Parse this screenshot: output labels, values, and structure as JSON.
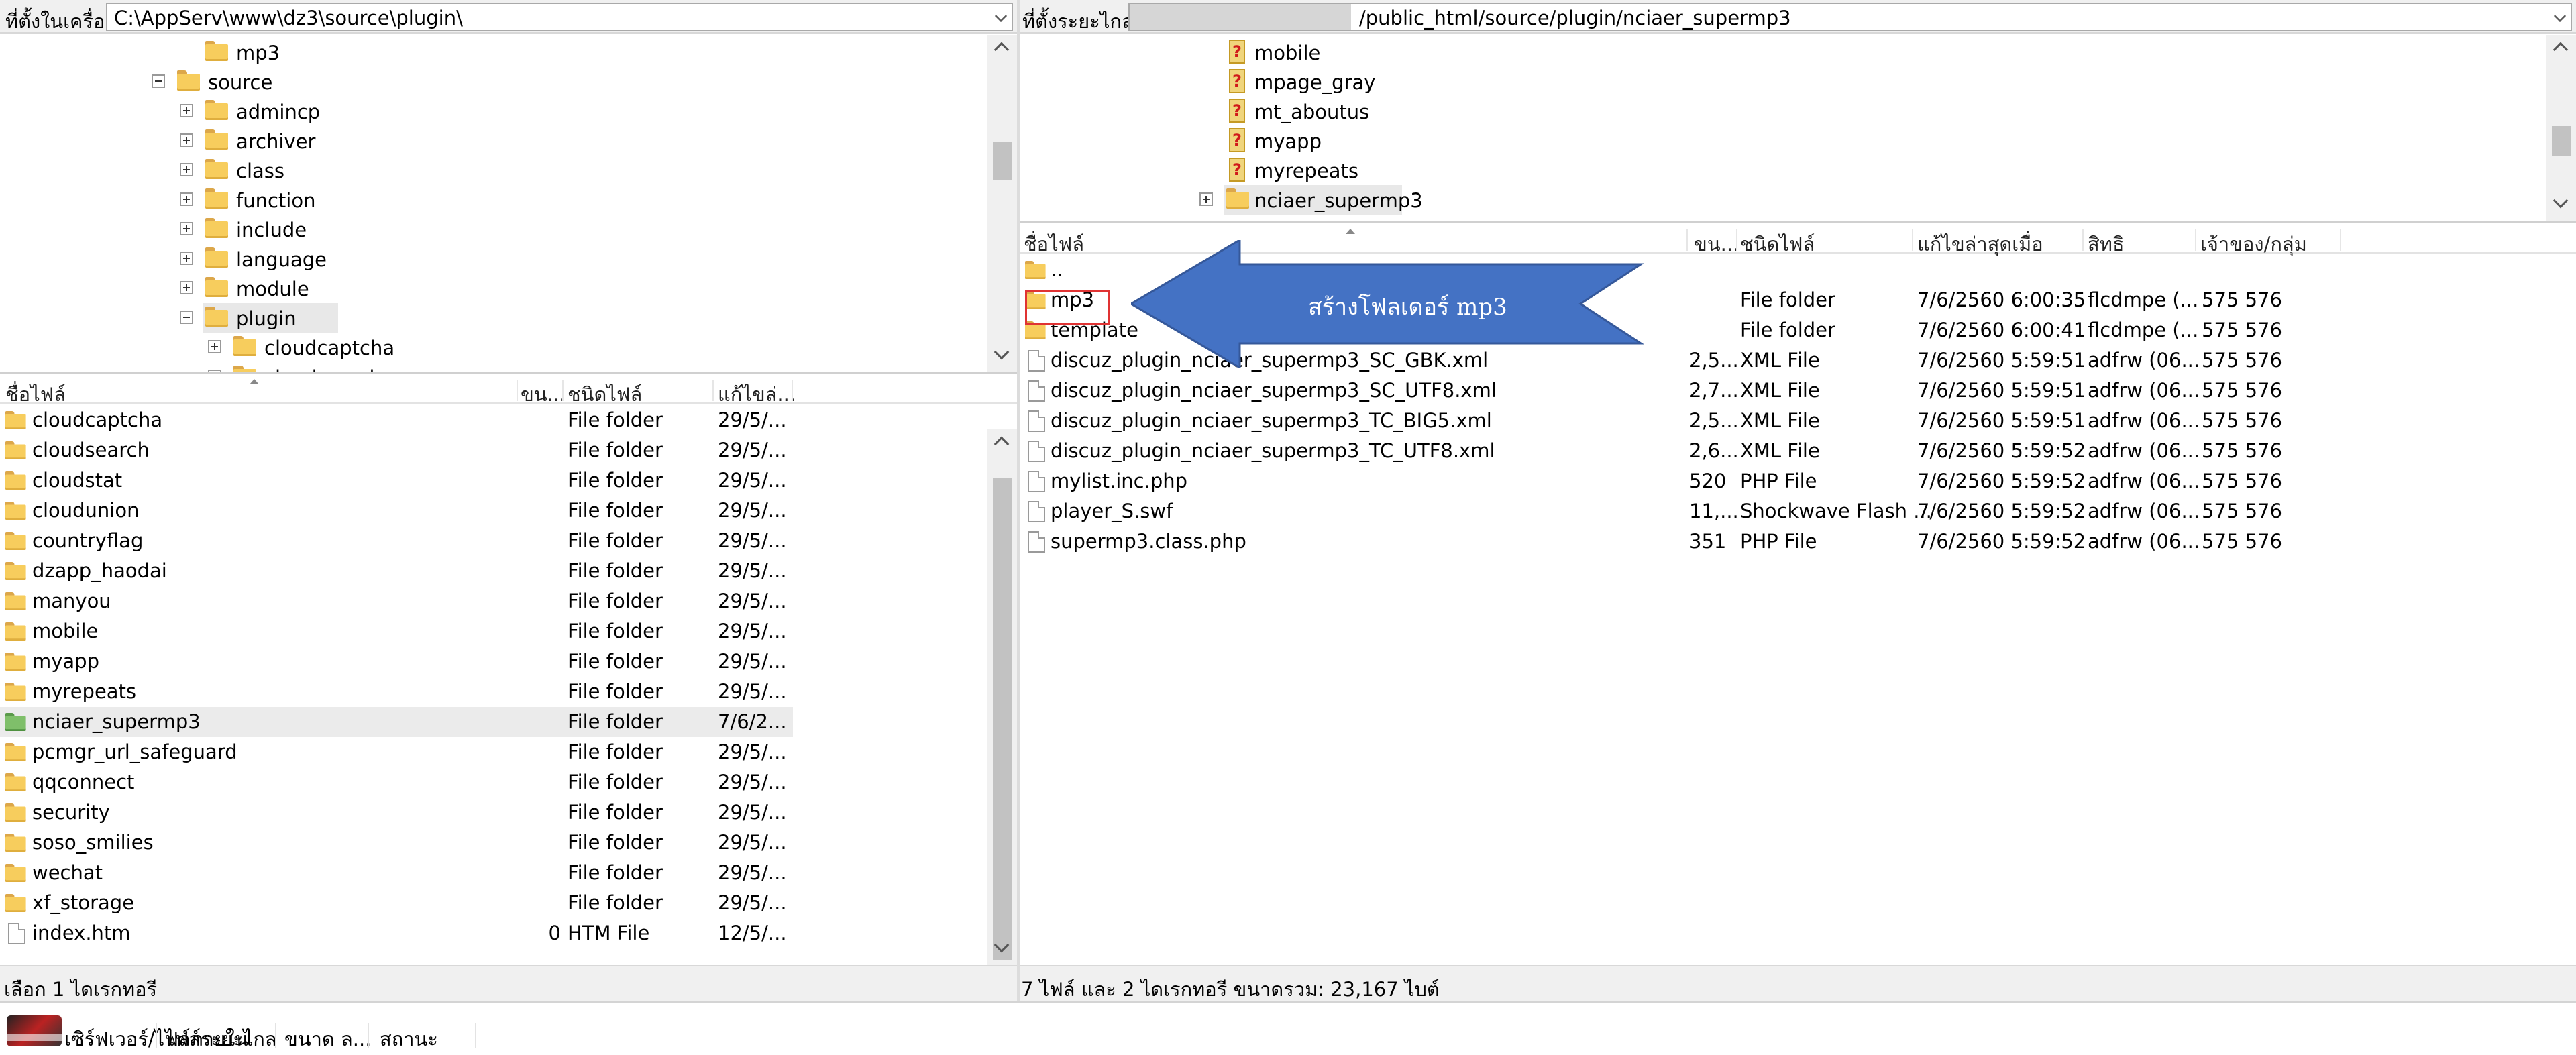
{
  "left": {
    "path_label": "ที่ตั้งในเครื่อง:",
    "path": "C:\\AppServ\\www\\dz3\\source\\plugin\\",
    "tree": [
      {
        "label": "mp3",
        "depth": 2,
        "expand": "none"
      },
      {
        "label": "source",
        "depth": 1,
        "expand": "minus"
      },
      {
        "label": "admincp",
        "depth": 2,
        "expand": "plus"
      },
      {
        "label": "archiver",
        "depth": 2,
        "expand": "plus"
      },
      {
        "label": "class",
        "depth": 2,
        "expand": "plus"
      },
      {
        "label": "function",
        "depth": 2,
        "expand": "plus"
      },
      {
        "label": "include",
        "depth": 2,
        "expand": "plus"
      },
      {
        "label": "language",
        "depth": 2,
        "expand": "plus"
      },
      {
        "label": "module",
        "depth": 2,
        "expand": "plus"
      },
      {
        "label": "plugin",
        "depth": 2,
        "expand": "minus",
        "selected": true
      },
      {
        "label": "cloudcaptcha",
        "depth": 3,
        "expand": "plus"
      },
      {
        "label": "cloudsearch",
        "depth": 3,
        "expand": "plus"
      }
    ],
    "columns": {
      "name": "ชื่อไฟล์",
      "size": "ขน...",
      "type": "ชนิดไฟล์",
      "modified": "แก้ไขล่..."
    },
    "files": [
      {
        "name": "cloudcaptcha",
        "size": "",
        "type": "File folder",
        "modified": "29/5/...",
        "kind": "folder"
      },
      {
        "name": "cloudsearch",
        "size": "",
        "type": "File folder",
        "modified": "29/5/...",
        "kind": "folder"
      },
      {
        "name": "cloudstat",
        "size": "",
        "type": "File folder",
        "modified": "29/5/...",
        "kind": "folder"
      },
      {
        "name": "cloudunion",
        "size": "",
        "type": "File folder",
        "modified": "29/5/...",
        "kind": "folder"
      },
      {
        "name": "countryflag",
        "size": "",
        "type": "File folder",
        "modified": "29/5/...",
        "kind": "folder"
      },
      {
        "name": "dzapp_haodai",
        "size": "",
        "type": "File folder",
        "modified": "29/5/...",
        "kind": "folder"
      },
      {
        "name": "manyou",
        "size": "",
        "type": "File folder",
        "modified": "29/5/...",
        "kind": "folder"
      },
      {
        "name": "mobile",
        "size": "",
        "type": "File folder",
        "modified": "29/5/...",
        "kind": "folder"
      },
      {
        "name": "myapp",
        "size": "",
        "type": "File folder",
        "modified": "29/5/...",
        "kind": "folder"
      },
      {
        "name": "myrepeats",
        "size": "",
        "type": "File folder",
        "modified": "29/5/...",
        "kind": "folder"
      },
      {
        "name": "nciaer_supermp3",
        "size": "",
        "type": "File folder",
        "modified": "7/6/2...",
        "kind": "folder-green",
        "selected": true
      },
      {
        "name": "pcmgr_url_safeguard",
        "size": "",
        "type": "File folder",
        "modified": "29/5/...",
        "kind": "folder"
      },
      {
        "name": "qqconnect",
        "size": "",
        "type": "File folder",
        "modified": "29/5/...",
        "kind": "folder"
      },
      {
        "name": "security",
        "size": "",
        "type": "File folder",
        "modified": "29/5/...",
        "kind": "folder"
      },
      {
        "name": "soso_smilies",
        "size": "",
        "type": "File folder",
        "modified": "29/5/...",
        "kind": "folder"
      },
      {
        "name": "wechat",
        "size": "",
        "type": "File folder",
        "modified": "29/5/...",
        "kind": "folder"
      },
      {
        "name": "xf_storage",
        "size": "",
        "type": "File folder",
        "modified": "29/5/...",
        "kind": "folder"
      },
      {
        "name": "index.htm",
        "size": "0",
        "type": "HTM File",
        "modified": "12/5/...",
        "kind": "file"
      }
    ],
    "status": "เลือก 1 ไดเรกทอรี"
  },
  "right": {
    "path_label": "ที่ตั้งระยะไกล:",
    "path": "/public_html/source/plugin/nciaer_supermp3",
    "tree": [
      {
        "label": "mobile",
        "expand": "none"
      },
      {
        "label": "mpage_gray",
        "expand": "none"
      },
      {
        "label": "mt_aboutus",
        "expand": "none"
      },
      {
        "label": "myapp",
        "expand": "none"
      },
      {
        "label": "myrepeats",
        "expand": "none"
      },
      {
        "label": "nciaer_supermp3",
        "expand": "plus",
        "selected": true,
        "folder": true
      }
    ],
    "columns": {
      "name": "ชื่อไฟล์",
      "size": "ขน...",
      "type": "ชนิดไฟล์",
      "modified": "แก้ไขล่าสุดเมื่อ",
      "perm": "สิทธิ",
      "owner": "เจ้าของ/กลุ่ม"
    },
    "files": [
      {
        "name": "..",
        "size": "",
        "type": "",
        "modified": "",
        "perm": "",
        "owner": "",
        "kind": "folder"
      },
      {
        "name": "mp3",
        "size": "",
        "type": "File folder",
        "modified": "7/6/2560 6:00:35",
        "perm": "flcdmpe (...",
        "owner": "575 576",
        "kind": "folder"
      },
      {
        "name": "template",
        "size": "",
        "type": "File folder",
        "modified": "7/6/2560 6:00:41",
        "perm": "flcdmpe (...",
        "owner": "575 576",
        "kind": "folder"
      },
      {
        "name": "discuz_plugin_nciaer_supermp3_SC_GBK.xml",
        "size": "2,5...",
        "type": "XML File",
        "modified": "7/6/2560 5:59:51",
        "perm": "adfrw (06...",
        "owner": "575 576",
        "kind": "file"
      },
      {
        "name": "discuz_plugin_nciaer_supermp3_SC_UTF8.xml",
        "size": "2,7...",
        "type": "XML File",
        "modified": "7/6/2560 5:59:51",
        "perm": "adfrw (06...",
        "owner": "575 576",
        "kind": "file"
      },
      {
        "name": "discuz_plugin_nciaer_supermp3_TC_BIG5.xml",
        "size": "2,5...",
        "type": "XML File",
        "modified": "7/6/2560 5:59:51",
        "perm": "adfrw (06...",
        "owner": "575 576",
        "kind": "file"
      },
      {
        "name": "discuz_plugin_nciaer_supermp3_TC_UTF8.xml",
        "size": "2,6...",
        "type": "XML File",
        "modified": "7/6/2560 5:59:52",
        "perm": "adfrw (06...",
        "owner": "575 576",
        "kind": "file"
      },
      {
        "name": "mylist.inc.php",
        "size": "520",
        "type": "PHP File",
        "modified": "7/6/2560 5:59:52",
        "perm": "adfrw (06...",
        "owner": "575 576",
        "kind": "file"
      },
      {
        "name": "player_S.swf",
        "size": "11,...",
        "type": "Shockwave Flash ...",
        "modified": "7/6/2560 5:59:52",
        "perm": "adfrw (06...",
        "owner": "575 576",
        "kind": "file"
      },
      {
        "name": "supermp3.class.php",
        "size": "351",
        "type": "PHP File",
        "modified": "7/6/2560 5:59:52",
        "perm": "adfrw (06...",
        "owner": "575 576",
        "kind": "file"
      }
    ],
    "status": "7 ไฟล์ และ 2 ไดเรกทอรี ขนาดรวม: 23,167 ไบต์"
  },
  "annotation": {
    "text": "สร้างโฟลเดอร์ mp3",
    "color": "#4472c4"
  },
  "queue": {
    "cols": [
      "เซิร์ฟเวอร์/ไฟล์ภายใน",
      "ไฟล์ระยะไกล",
      "ขนาด ล...",
      "สถานะ"
    ]
  }
}
